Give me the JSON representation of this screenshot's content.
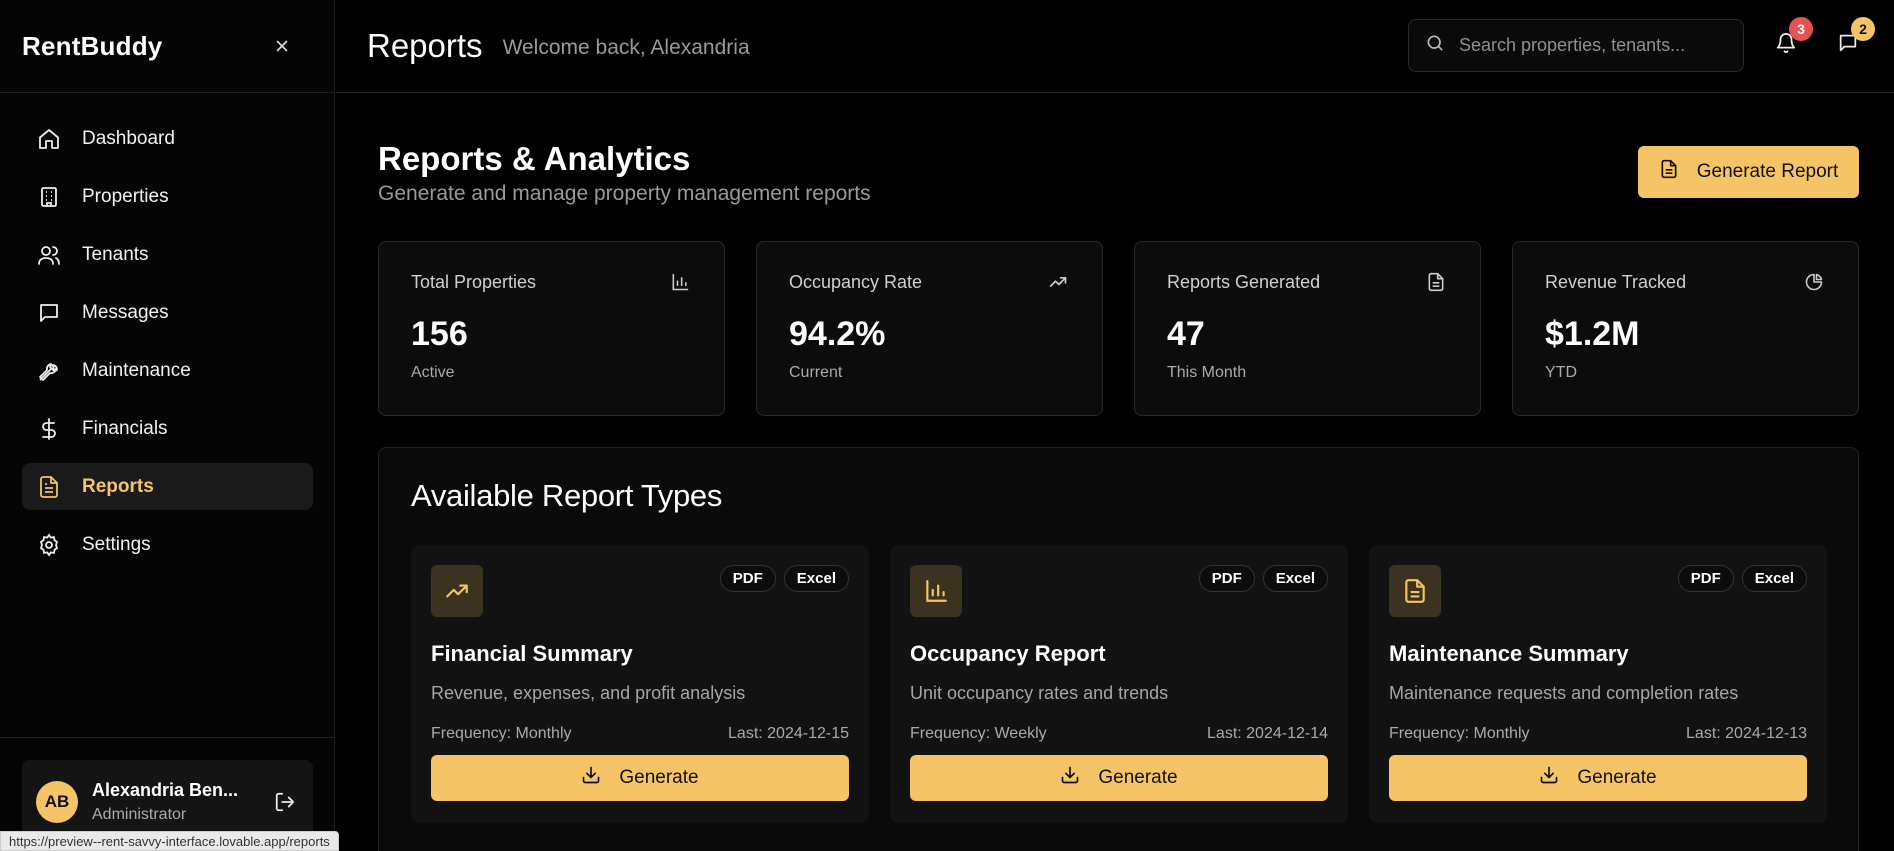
{
  "sidebar": {
    "brand": "RentBuddy",
    "items": [
      {
        "label": "Dashboard",
        "icon": "home-icon"
      },
      {
        "label": "Properties",
        "icon": "building-icon"
      },
      {
        "label": "Tenants",
        "icon": "users-icon"
      },
      {
        "label": "Messages",
        "icon": "message-icon"
      },
      {
        "label": "Maintenance",
        "icon": "wrench-icon"
      },
      {
        "label": "Financials",
        "icon": "dollar-icon"
      },
      {
        "label": "Reports",
        "icon": "file-text-icon",
        "active": true
      },
      {
        "label": "Settings",
        "icon": "gear-icon"
      }
    ],
    "user": {
      "initials": "AB",
      "name": "Alexandria Ben...",
      "role": "Administrator"
    }
  },
  "header": {
    "title": "Reports",
    "welcome": "Welcome back, Alexandria",
    "search_placeholder": "Search properties, tenants...",
    "notifications_count": "3",
    "messages_count": "2"
  },
  "main": {
    "title": "Reports & Analytics",
    "subtitle": "Generate and manage property management reports",
    "generate_label": "Generate Report",
    "stats": [
      {
        "label": "Total Properties",
        "value": "156",
        "note": "Active",
        "icon": "bar-chart-icon"
      },
      {
        "label": "Occupancy Rate",
        "value": "94.2%",
        "note": "Current",
        "icon": "trending-up-icon"
      },
      {
        "label": "Reports Generated",
        "value": "47",
        "note": "This Month",
        "icon": "file-text-icon"
      },
      {
        "label": "Revenue Tracked",
        "value": "$1.2M",
        "note": "YTD",
        "icon": "pie-chart-icon"
      }
    ],
    "report_types_title": "Available Report Types",
    "report_types": [
      {
        "name": "Financial Summary",
        "desc": "Revenue, expenses, and profit analysis",
        "frequency": "Frequency: Monthly",
        "last": "Last: 2024-12-15",
        "formats": [
          "PDF",
          "Excel"
        ],
        "button": "Generate",
        "icon": "trending-up-icon"
      },
      {
        "name": "Occupancy Report",
        "desc": "Unit occupancy rates and trends",
        "frequency": "Frequency: Weekly",
        "last": "Last: 2024-12-14",
        "formats": [
          "PDF",
          "Excel"
        ],
        "button": "Generate",
        "icon": "bar-chart-icon"
      },
      {
        "name": "Maintenance Summary",
        "desc": "Maintenance requests and completion rates",
        "frequency": "Frequency: Monthly",
        "last": "Last: 2024-12-13",
        "formats": [
          "PDF",
          "Excel"
        ],
        "button": "Generate",
        "icon": "file-text-icon"
      }
    ]
  },
  "status_url": "https://preview--rent-savvy-interface.lovable.app/reports",
  "colors": {
    "accent": "#f4c466",
    "background": "#000000",
    "card": "#0c0c0c",
    "badge_red": "#e55353"
  }
}
